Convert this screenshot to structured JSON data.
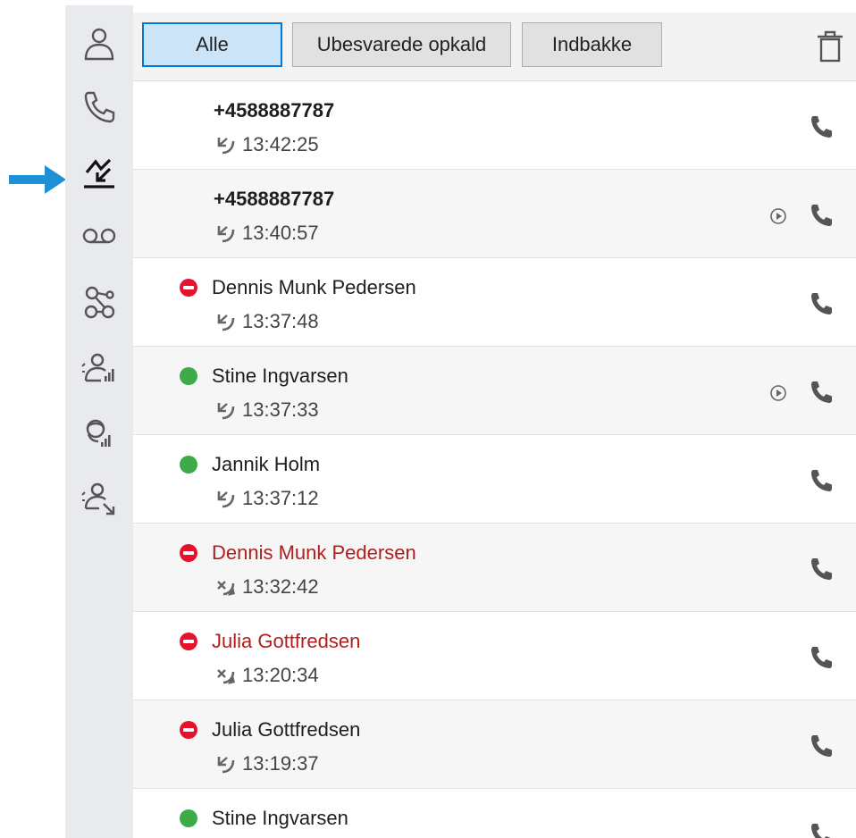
{
  "accent_color": "#0078d7",
  "arrow_color": "#1e90d6",
  "sidebar": {
    "items": [
      {
        "icon": "contact-icon"
      },
      {
        "icon": "phone-icon"
      },
      {
        "icon": "call-history-icon",
        "active": true
      },
      {
        "icon": "voicemail-icon"
      },
      {
        "icon": "queues-icon"
      },
      {
        "icon": "agent-status-icon"
      },
      {
        "icon": "headset-status-icon"
      },
      {
        "icon": "agent-transfer-icon"
      }
    ]
  },
  "toolbar": {
    "tabs": [
      {
        "label": "Alle",
        "active": true
      },
      {
        "label": "Ubesvarede opkald",
        "active": false
      },
      {
        "label": "Indbakke",
        "active": false
      }
    ],
    "trash_icon": "trash-icon"
  },
  "calls": [
    {
      "name": "+4588887787",
      "time": "13:42:25",
      "status": "none",
      "direction": "incoming",
      "missed": false,
      "is_number": true,
      "recording": false
    },
    {
      "name": "+4588887787",
      "time": "13:40:57",
      "status": "none",
      "direction": "incoming",
      "missed": false,
      "is_number": true,
      "recording": true
    },
    {
      "name": "Dennis Munk Pedersen",
      "time": "13:37:48",
      "status": "busy",
      "direction": "incoming",
      "missed": false,
      "is_number": false,
      "recording": false
    },
    {
      "name": "Stine Ingvarsen",
      "time": "13:37:33",
      "status": "online",
      "direction": "incoming",
      "missed": false,
      "is_number": false,
      "recording": true
    },
    {
      "name": "Jannik Holm",
      "time": "13:37:12",
      "status": "online",
      "direction": "incoming",
      "missed": false,
      "is_number": false,
      "recording": false
    },
    {
      "name": "Dennis Munk Pedersen",
      "time": "13:32:42",
      "status": "busy",
      "direction": "missed",
      "missed": true,
      "is_number": false,
      "recording": false
    },
    {
      "name": "Julia Gottfredsen",
      "time": "13:20:34",
      "status": "busy",
      "direction": "missed",
      "missed": true,
      "is_number": false,
      "recording": false
    },
    {
      "name": "Julia Gottfredsen",
      "time": "13:19:37",
      "status": "busy",
      "direction": "incoming",
      "missed": false,
      "is_number": false,
      "recording": false
    },
    {
      "name": "Stine Ingvarsen",
      "time": "",
      "status": "online",
      "direction": "incoming",
      "missed": false,
      "is_number": false,
      "recording": false
    }
  ]
}
